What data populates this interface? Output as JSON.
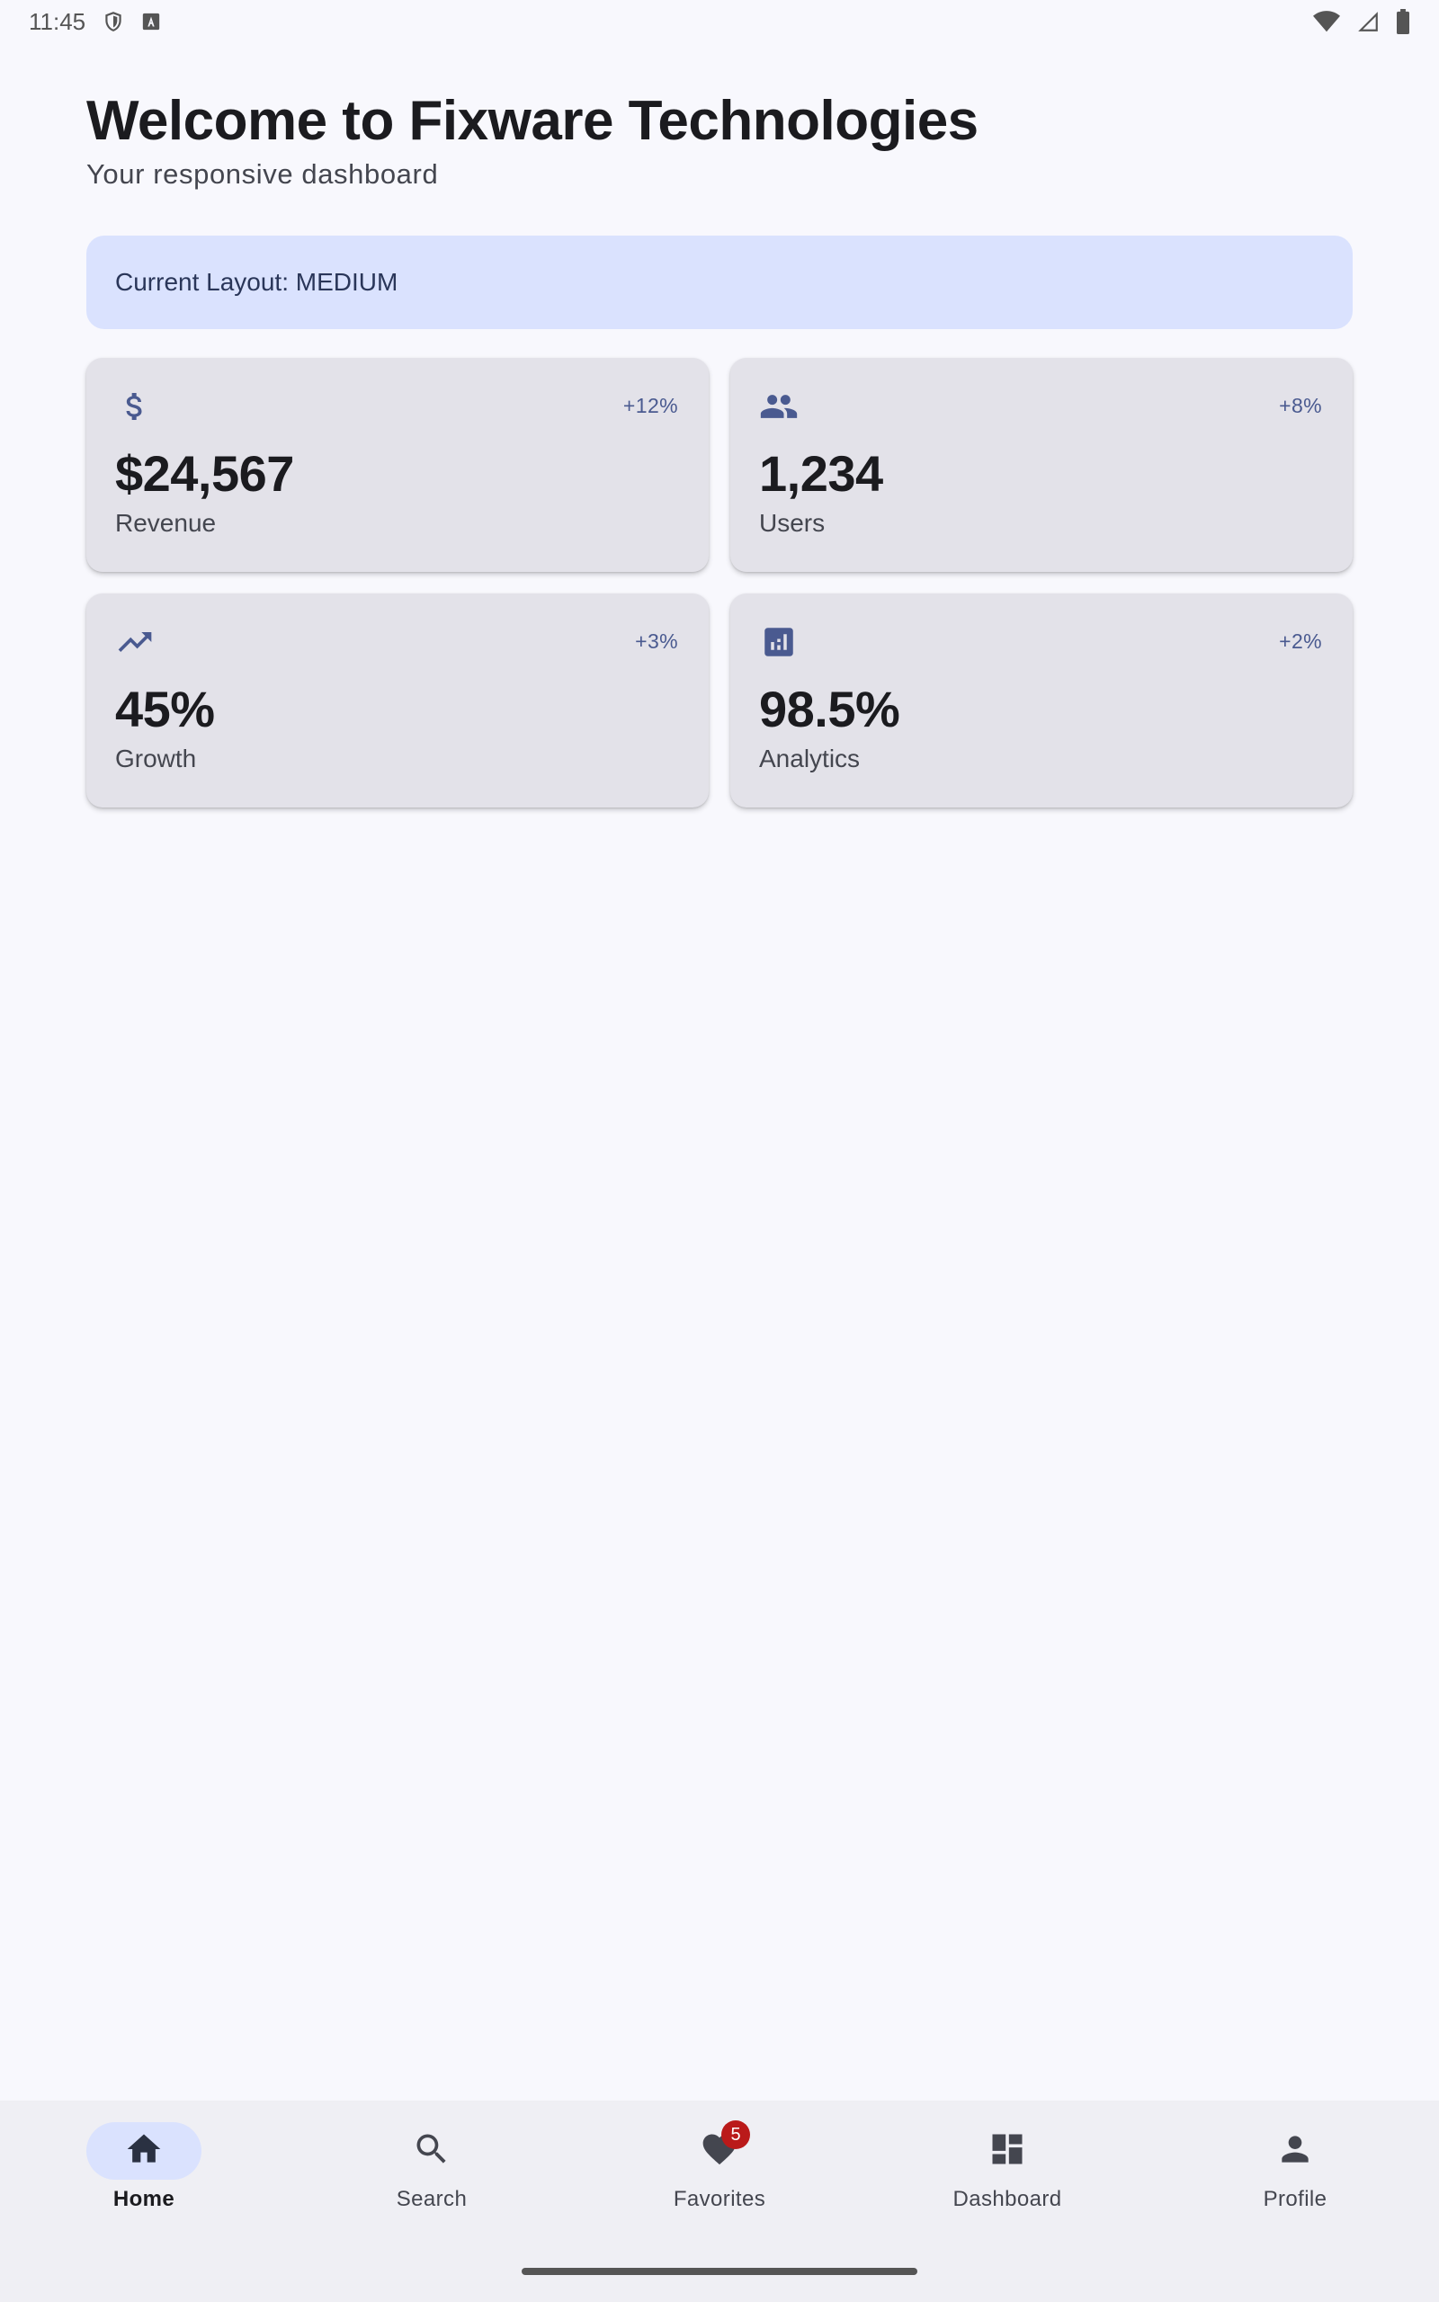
{
  "status_bar": {
    "time": "11:45"
  },
  "header": {
    "title": "Welcome to Fixware Technologies",
    "subtitle": "Your responsive dashboard"
  },
  "layout_banner": {
    "text": "Current Layout: MEDIUM"
  },
  "stats": [
    {
      "icon": "dollar-icon",
      "value": "$24,567",
      "label": "Revenue",
      "change": "+12%"
    },
    {
      "icon": "people-icon",
      "value": "1,234",
      "label": "Users",
      "change": "+8%"
    },
    {
      "icon": "trending-up-icon",
      "value": "45%",
      "label": "Growth",
      "change": "+3%"
    },
    {
      "icon": "analytics-icon",
      "value": "98.5%",
      "label": "Analytics",
      "change": "+2%"
    }
  ],
  "bottom_nav": {
    "items": [
      {
        "label": "Home",
        "icon": "home-icon",
        "active": true
      },
      {
        "label": "Search",
        "icon": "search-icon"
      },
      {
        "label": "Favorites",
        "icon": "heart-icon",
        "badge": "5"
      },
      {
        "label": "Dashboard",
        "icon": "dashboard-icon"
      },
      {
        "label": "Profile",
        "icon": "person-icon"
      }
    ]
  },
  "colors": {
    "background": "#f8f8fd",
    "accent": "#4a5a90",
    "banner": "#dae2fe",
    "card": "#e3e2e9",
    "badge": "#ba1a1a"
  }
}
